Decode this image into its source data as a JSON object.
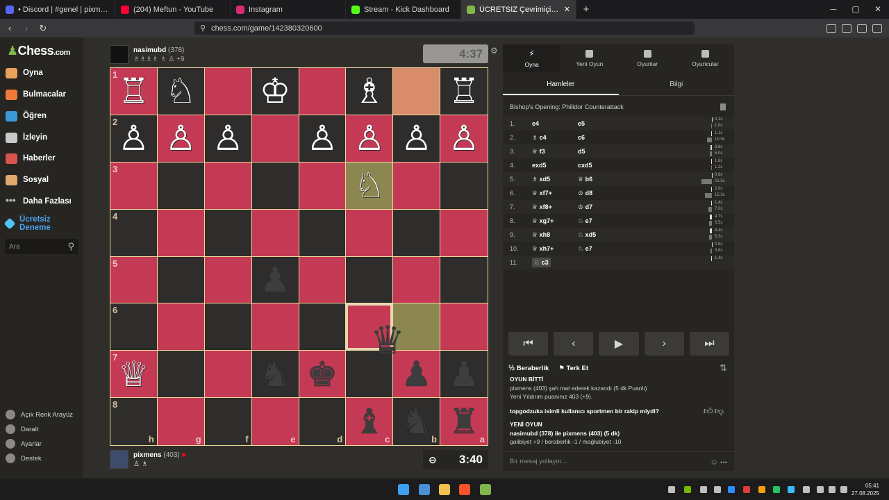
{
  "browser": {
    "tabs": [
      {
        "title": "• Discord | #genel | pixmens",
        "color": "#5865f2"
      },
      {
        "title": "(204) Meftun - YouTube",
        "color": "#ff0033"
      },
      {
        "title": "Instagram",
        "color": "#d62976"
      },
      {
        "title": "Stream - Kick Dashboard",
        "color": "#53fc18"
      },
      {
        "title": "ÜCRETSİZ Çevrimiçi Satranç (",
        "color": "#81b64c"
      }
    ],
    "new_tab": "+",
    "url": "chess.com/game/142380320600"
  },
  "sidebar": {
    "logo": "Chess",
    "logo_suffix": ".com",
    "items": [
      {
        "label": "Oyna",
        "icon": "pawn-play-icon",
        "color": "#e8a25b"
      },
      {
        "label": "Bulmacalar",
        "icon": "puzzle-icon",
        "color": "#ef7a3a"
      },
      {
        "label": "Öğren",
        "icon": "learn-icon",
        "color": "#3a9ad9"
      },
      {
        "label": "İzleyin",
        "icon": "binoculars-icon",
        "color": "#c9c9c9"
      },
      {
        "label": "Haberler",
        "icon": "news-icon",
        "color": "#d9534f"
      },
      {
        "label": "Sosyal",
        "icon": "social-icon",
        "color": "#e0a86b"
      },
      {
        "label": "Daha Fazlası",
        "icon": "more-icon",
        "color": "#bbbbbb"
      }
    ],
    "trial": "Ücretsiz Deneme",
    "search_placeholder": "Ara",
    "bottom": [
      "Açık Renk Arayüz",
      "Daralt",
      "Ayarlar",
      "Destek"
    ]
  },
  "opponent": {
    "name": "nasimubd",
    "rating": "(378)",
    "captured": "♗♗♗♗ ♗ ♙ +9",
    "clock": "4:37"
  },
  "me": {
    "name": "pixmens",
    "rating": "(403)",
    "captured": "♙ ♗",
    "clock": "3:40"
  },
  "board": {
    "ranks": [
      "1",
      "2",
      "3",
      "4",
      "5",
      "6",
      "7",
      "8"
    ],
    "files": [
      "h",
      "g",
      "f",
      "e",
      "d",
      "c",
      "b",
      "a"
    ],
    "squares": [
      [
        "♖",
        "♘",
        "",
        "♔",
        "",
        "♗",
        "",
        "♖"
      ],
      [
        "♙",
        "♙",
        "♙",
        "",
        "♙",
        "♙",
        "♙",
        "♙"
      ],
      [
        "",
        "",
        "",
        "",
        "",
        "♘",
        "",
        ""
      ],
      [
        "",
        "",
        "",
        "",
        "",
        "",
        "",
        ""
      ],
      [
        "",
        "",
        "",
        "♟",
        "",
        "",
        "",
        ""
      ],
      [
        "",
        "",
        "",
        "",
        "",
        "",
        "",
        ""
      ],
      [
        "♕",
        "",
        "",
        "♞",
        "♚",
        "",
        "♟",
        "♟"
      ],
      [
        "",
        "",
        "",
        "",
        "",
        "♝",
        "♞",
        "♜"
      ]
    ],
    "light_color": "#c43a55",
    "dark_color": "#2e2d2b",
    "dragging_piece": "♛"
  },
  "panel": {
    "tabs": [
      {
        "label": "Oyna",
        "icon": "lightning-icon"
      },
      {
        "label": "Yeni Oyun",
        "icon": "plus-icon"
      },
      {
        "label": "Oyunlar",
        "icon": "board-icon"
      },
      {
        "label": "Oyuncular",
        "icon": "players-icon"
      }
    ],
    "subtabs": [
      "Hamleler",
      "Bilgi"
    ],
    "opening": "Bishop's Opening: Philidor Counterattack",
    "moves": [
      {
        "n": "1.",
        "w": "e4",
        "b": "e5",
        "tw": "0.1s",
        "tb": "1.0s",
        "pw": 2,
        "pb": 3
      },
      {
        "n": "2.",
        "w": "♗ c4",
        "b": "c6",
        "tw": "1.1s",
        "tb": "10.9s",
        "pw": 3,
        "pb": 30
      },
      {
        "n": "3.",
        "w": "♕ f3",
        "b": "d5",
        "tw": "3.8s",
        "tb": "5.0s",
        "pw": 10,
        "pb": 14
      },
      {
        "n": "4.",
        "w": "exd5",
        "b": "cxd5",
        "tw": "1.6s",
        "tb": "1.2s",
        "pw": 4,
        "pb": 3
      },
      {
        "n": "5.",
        "w": "♗ xd5",
        "b": "♕ b6",
        "tw": "0.8s",
        "tb": "21.5s",
        "pw": 2,
        "pb": 60
      },
      {
        "n": "6.",
        "w": "♕ xf7+",
        "b": "♔ d8",
        "tw": "2.0s",
        "tb": "15.3s",
        "pw": 5,
        "pb": 42
      },
      {
        "n": "7.",
        "w": "♕ xf8+",
        "b": "♔ d7",
        "tw": "1.4s",
        "tb": "7.0s",
        "pw": 4,
        "pb": 19
      },
      {
        "n": "8.",
        "w": "♕ xg7+",
        "b": "♘ e7",
        "tw": "4.7s",
        "tb": "6.5s",
        "pw": 13,
        "pb": 18
      },
      {
        "n": "9.",
        "w": "♕ xh8",
        "b": "♘ xd5",
        "tw": "4.4s",
        "tb": "5.3s",
        "pw": 12,
        "pb": 15
      },
      {
        "n": "10.",
        "w": "♕ xh7+",
        "b": "♘ e7",
        "tw": "0.8s",
        "tb": "3.6s",
        "pw": 2,
        "pb": 10
      },
      {
        "n": "11.",
        "w": "♘ c3",
        "b": "",
        "tw": "1.4s",
        "tb": "",
        "pw": 4,
        "pb": 0
      }
    ],
    "controls": [
      "⏮",
      "‹",
      "▶",
      "›",
      "⏭"
    ],
    "draw": "Beraberlik",
    "draw_prefix": "½",
    "resign": "Terk Et",
    "chat": {
      "over_title": "OYUN BİTTİ",
      "result": "pixmens (403) şah mat ederek kazandı (5 dk Puanlı)",
      "blitz": "Yeni Yıldırım puanınız 403 (+9).",
      "sports": "topgodzuka isimli kullanıcı sportmen bir rakip miydi?",
      "new_game": "YENİ OYUN",
      "vs": "nasimubd (378) ile pixmens (403) (5 dk)",
      "stakes": "galibiyet +9 / beraberlik -1 / mağlubiyet -10"
    },
    "chat_placeholder": "Bir mesaj yollayın..."
  },
  "taskbar": {
    "time": "05:41",
    "date": "27.08.2025"
  }
}
